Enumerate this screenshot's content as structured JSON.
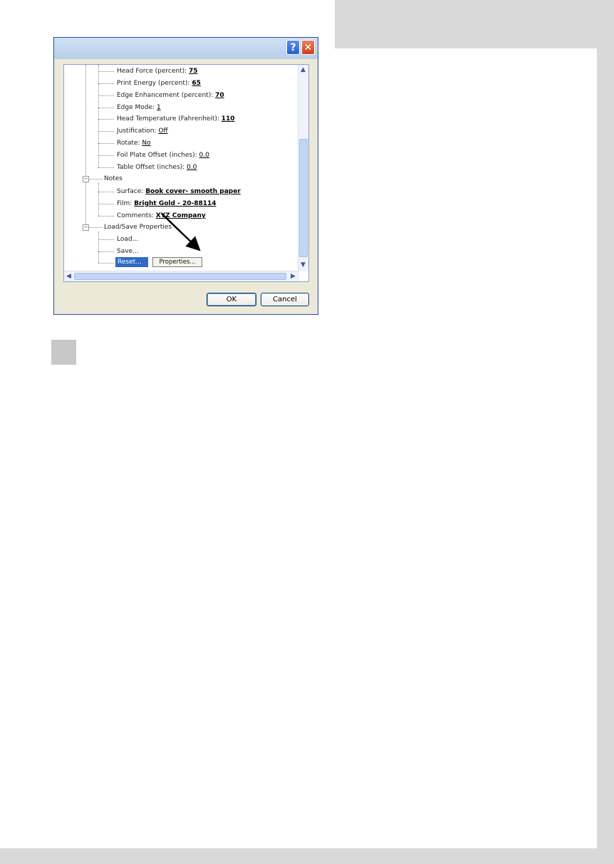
{
  "dialog": {
    "help_label": "?",
    "close_label": "✕",
    "ok_label": "OK",
    "cancel_label": "Cancel",
    "reset_label": "Reset...",
    "properties_label": "Properties...",
    "tree": {
      "head_force": {
        "label": "Head Force (percent): ",
        "value": "75"
      },
      "print_energy": {
        "label": "Print Energy (percent): ",
        "value": "65"
      },
      "edge_enhancement": {
        "label": "Edge Enhancement (percent): ",
        "value": "70"
      },
      "edge_mode": {
        "label": "Edge Mode: ",
        "value": "1"
      },
      "head_temperature": {
        "label": "Head Temperature (Fahrenheit): ",
        "value": "110"
      },
      "justification": {
        "label": "Justification: ",
        "value": "Off"
      },
      "rotate": {
        "label": "Rotate: ",
        "value": "No"
      },
      "foil_plate_offset": {
        "label": "Foil Plate Offset (inches): ",
        "value": "0.0"
      },
      "table_offset": {
        "label": "Table Offset (inches): ",
        "value": "0.0"
      },
      "notes": "Notes",
      "surface": {
        "label": "Surface: ",
        "value": "Book cover- smooth paper"
      },
      "film": {
        "label": "Film: ",
        "value": "Bright Gold - 20-88114"
      },
      "comments": {
        "label": "Comments: ",
        "value": "XYZ Company"
      },
      "load_save": "Load/Save Properties",
      "load": "Load...",
      "save": "Save..."
    },
    "colors": {
      "selection": "#316ac5",
      "titlebar": "#c3d7ef"
    }
  },
  "icons": {
    "expander": "minus-box-icon",
    "arrow": "annotation-arrow"
  }
}
